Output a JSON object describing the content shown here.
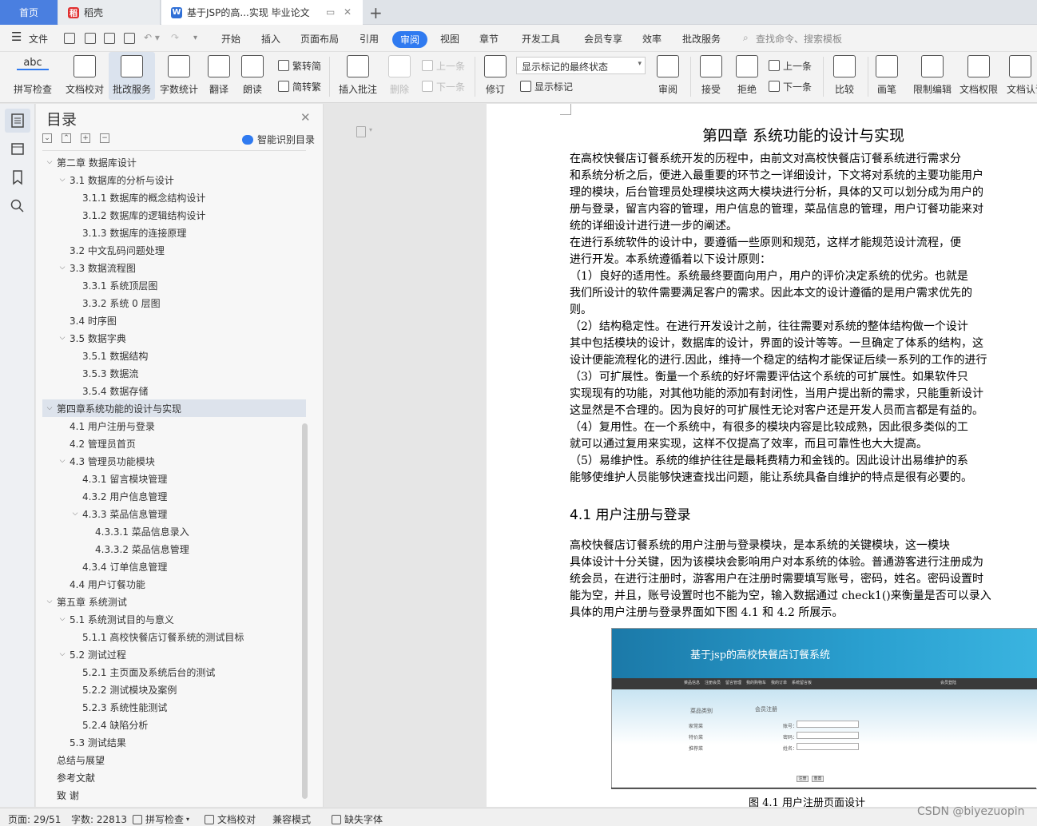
{
  "tabs": {
    "home": "首页",
    "daoke": "稻壳",
    "doc": "基于JSP的高...实现 毕业论文"
  },
  "menu": {
    "file": "文件",
    "items": [
      "开始",
      "插入",
      "页面布局",
      "引用",
      "审阅",
      "视图",
      "章节",
      "开发工具",
      "会员专享",
      "效率",
      "批改服务"
    ],
    "search": "查找命令、搜索模板"
  },
  "ribbon": {
    "spell": "拼写检查",
    "doccheck": "文档校对",
    "correction": "批改服务",
    "wordcount": "字数统计",
    "translate": "翻译",
    "read": "朗读",
    "trad": "繁转简",
    "simp": "简转繁",
    "insert_comment": "插入批注",
    "delete": "删除",
    "prev_comment": "上一条",
    "next_comment": "下一条",
    "revise": "修订",
    "markup_state": "显示标记的最终状态",
    "show_markup": "显示标记",
    "review": "审阅",
    "accept": "接受",
    "reject": "拒绝",
    "prev_change": "上一条",
    "next_change": "下一条",
    "compare": "比较",
    "pen": "画笔",
    "restrict": "限制编辑",
    "doc_perm": "文档权限",
    "doc_cert": "文档认证"
  },
  "toc": {
    "title": "目录",
    "smart": "智能识别目录",
    "items": [
      {
        "t": "第二章  数据库设计",
        "lvl": 0,
        "car": "v"
      },
      {
        "t": "3.1 数据库的分析与设计",
        "lvl": 1,
        "car": "v"
      },
      {
        "t": "3.1.1 数据库的概念结构设计",
        "lvl": 2
      },
      {
        "t": "3.1.2 数据库的逻辑结构设计",
        "lvl": 2
      },
      {
        "t": "3.1.3 数据库的连接原理",
        "lvl": 2
      },
      {
        "t": "3.2 中文乱码问题处理",
        "lvl": 1
      },
      {
        "t": "3.3 数据流程图",
        "lvl": 1,
        "car": "v"
      },
      {
        "t": "3.3.1 系统顶层图",
        "lvl": 2
      },
      {
        "t": "3.3.2 系统 0 层图",
        "lvl": 2
      },
      {
        "t": "3.4 时序图",
        "lvl": 1
      },
      {
        "t": "3.5  数据字典",
        "lvl": 1,
        "car": "v"
      },
      {
        "t": "3.5.1  数据结构",
        "lvl": 2
      },
      {
        "t": "3.5.3  数据流",
        "lvl": 2
      },
      {
        "t": "3.5.4 数据存储",
        "lvl": 2
      },
      {
        "t": "第四章系统功能的设计与实现",
        "lvl": 0,
        "car": "v",
        "sel": true
      },
      {
        "t": "4.1 用户注册与登录",
        "lvl": 1
      },
      {
        "t": "4.2 管理员首页",
        "lvl": 1
      },
      {
        "t": "4.3 管理员功能模块",
        "lvl": 1,
        "car": "v"
      },
      {
        "t": "4.3.1 留言模块管理",
        "lvl": 2
      },
      {
        "t": "4.3.2 用户信息管理",
        "lvl": 2
      },
      {
        "t": "4.3.3 菜品信息管理",
        "lvl": 2,
        "car": "v"
      },
      {
        "t": "4.3.3.1 菜品信息录入",
        "lvl": 3
      },
      {
        "t": "4.3.3.2 菜品信息管理",
        "lvl": 3
      },
      {
        "t": "4.3.4 订单信息管理",
        "lvl": 2
      },
      {
        "t": "4.4 用户订餐功能",
        "lvl": 1
      },
      {
        "t": "第五章  系统测试",
        "lvl": 0,
        "car": "v"
      },
      {
        "t": "5.1 系统测试目的与意义",
        "lvl": 1,
        "car": "v"
      },
      {
        "t": "5.1.1  高校快餐店订餐系统的测试目标",
        "lvl": 2
      },
      {
        "t": "5.2 测试过程",
        "lvl": 1,
        "car": "v"
      },
      {
        "t": "5.2.1 主页面及系统后台的测试",
        "lvl": 2
      },
      {
        "t": "5.2.2 测试模块及案例",
        "lvl": 2
      },
      {
        "t": "5.2.3 系统性能测试",
        "lvl": 2
      },
      {
        "t": "5.2.4 缺陷分析",
        "lvl": 2
      },
      {
        "t": "5.3 测试结果",
        "lvl": 1
      },
      {
        "t": "总结与展望",
        "lvl": 0
      },
      {
        "t": "参考文献",
        "lvl": 0
      },
      {
        "t": "致      谢",
        "lvl": 0
      }
    ]
  },
  "doc": {
    "chapter_title": "第四章  系统功能的设计与实现",
    "lines": [
      "    在高校快餐店订餐系统开发的历程中，由前文对高校快餐店订餐系统进行需求分",
      "和系统分析之后，便进入最重要的环节之一详细设计，下文将对系统的主要功能用户",
      "理的模块，后台管理员处理模块这两大模块进行分析，具体的又可以划分成为用户的",
      "册与登录，留言内容的管理，用户信息的管理，菜品信息的管理，用户订餐功能来对",
      "统的详细设计进行进一步的阐述。",
      "    在进行系统软件的设计中，要遵循一些原则和规范，这样才能规范设计流程，便",
      "进行开发。本系统遵循着以下设计原则：",
      "    （1）良好的适用性。系统最终要面向用户，用户的评价决定系统的优劣。也就是",
      "我们所设计的软件需要满足客户的需求。因此本文的设计遵循的是用户需求优先的",
      "则。",
      "    （2）结构稳定性。在进行开发设计之前，往往需要对系统的整体结构做一个设计",
      "其中包括模块的设计，数据库的设计，界面的设计等等。一旦确定了体系的结构，这",
      "设计便能流程化的进行.因此，维持一个稳定的结构才能保证后续一系列的工作的进行",
      "    （3）可扩展性。衡量一个系统的好坏需要评估这个系统的可扩展性。如果软件只",
      "实现现有的功能，对其他功能的添加有封闭性，当用户提出新的需求，只能重新设计",
      "这显然是不合理的。因为良好的可扩展性无论对客户还是开发人员而言都是有益的。",
      "    （4）复用性。在一个系统中，有很多的模块内容是比较成熟，因此很多类似的工",
      "就可以通过复用来实现，这样不仅提高了效率，而且可靠性也大大提高。",
      "    （5）易维护性。系统的维护往往是最耗费精力和金钱的。因此设计出易维护的系",
      "能够使维护人员能够快速查找出问题，能让系统具备自维护的特点是很有必要的。"
    ],
    "section_title": "4.1 用户注册与登录",
    "lines2": [
      "    高校快餐店订餐系统的用户注册与登录模块，是本系统的关键模块，这一模块",
      "具体设计十分关键，因为该模块会影响用户对本系统的体验。普通游客进行注册成为",
      "统会员，在进行注册时，游客用户在注册时需要填写账号，密码，姓名。密码设置时",
      "能为空，并且，账号设置时也不能为空，输入数据通过 check1()来衡量是否可以录入",
      "具体的用户注册与登录界面如下图 4.1 和 4.2 所展示。"
    ],
    "figure": {
      "title": "基于jsp的高校快餐店订餐系统",
      "nav": [
        "菜品信息",
        "注册会员",
        "留言管理",
        "我的购物车",
        "我的订单",
        "系统留言板"
      ],
      "nav_right": "会员登陆",
      "left_title": "菜品类别",
      "left_items": [
        "家常菜",
        "特价菜",
        "推荐菜"
      ],
      "form_title": "会员注册",
      "fields": [
        "账号：",
        "密码：",
        "姓名："
      ],
      "buttons": [
        "注册",
        "重置"
      ]
    },
    "caption": "图 4.1 用户注册页面设计"
  },
  "status": {
    "page": "页面: 29/51",
    "words": "字数: 22813",
    "spell": "拼写检查",
    "doccheck": "文档校对",
    "compat": "兼容模式",
    "missing_font": "缺失字体"
  },
  "watermark": "CSDN @biyezuopin"
}
